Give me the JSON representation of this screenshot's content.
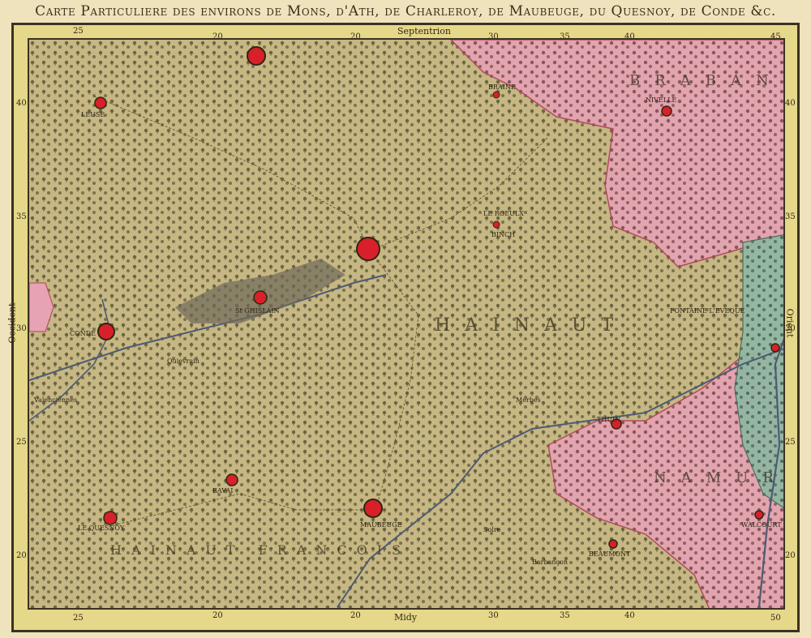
{
  "title": "Carte Particuliere des environs de Mons, d'Ath, de Charleroy, de Maubeuge, du Quesnoy, de Conde &c.",
  "compass": {
    "north": "Septentrion",
    "south": "Midy",
    "west": "Occident",
    "east": "Orient"
  },
  "top_ticks": [
    "25",
    "20",
    "20",
    "30",
    "35",
    "40",
    "45"
  ],
  "bottom_ticks": [
    "25",
    "20",
    "20",
    "30",
    "35",
    "40",
    "50"
  ],
  "left_ticks": [
    "40",
    "35",
    "30",
    "25",
    "20"
  ],
  "right_ticks": [
    "40",
    "35",
    "30",
    "25",
    "20"
  ],
  "places": [
    {
      "name": "MAUBEUGE",
      "fortified": true
    },
    {
      "name": "BINCH",
      "fortified": false
    },
    {
      "name": "LE QUESNOY",
      "fortified": true
    },
    {
      "name": "BAVAI",
      "fortified": true
    },
    {
      "name": "CONDE",
      "fortified": true
    },
    {
      "name": "NIVELLE",
      "fortified": true
    },
    {
      "name": "THUIN",
      "fortified": true
    },
    {
      "name": "BEAUMONT",
      "fortified": true
    },
    {
      "name": "WALCOURT",
      "fortified": true
    },
    {
      "name": "FONTAINE L'EVEQUE",
      "fortified": false
    },
    {
      "name": "BRAINE",
      "fortified": false
    },
    {
      "name": "LE ROEULX",
      "fortified": false
    },
    {
      "name": "St GHISLAIN",
      "fortified": true
    },
    {
      "name": "LEUSE",
      "fortified": true
    },
    {
      "name": "Quievrain",
      "fortified": false
    },
    {
      "name": "Barbançon",
      "fortified": false
    },
    {
      "name": "Solre",
      "fortified": false
    },
    {
      "name": "Merbes",
      "fortified": false
    },
    {
      "name": "Valenciennes",
      "fortified": false
    }
  ],
  "regions": [
    "HAINAUT",
    "BRABANT",
    "NAMUR",
    "HAINAUT FRANCOIS"
  ],
  "colors": {
    "frame_yellow": "#e6d88a",
    "brabant_pink": "#e5a3b3",
    "namur_green": "#8fb7a3",
    "hainaut_base": "#cdbf8a",
    "fortress_red": "#d8202a",
    "ink": "#2e2614"
  }
}
